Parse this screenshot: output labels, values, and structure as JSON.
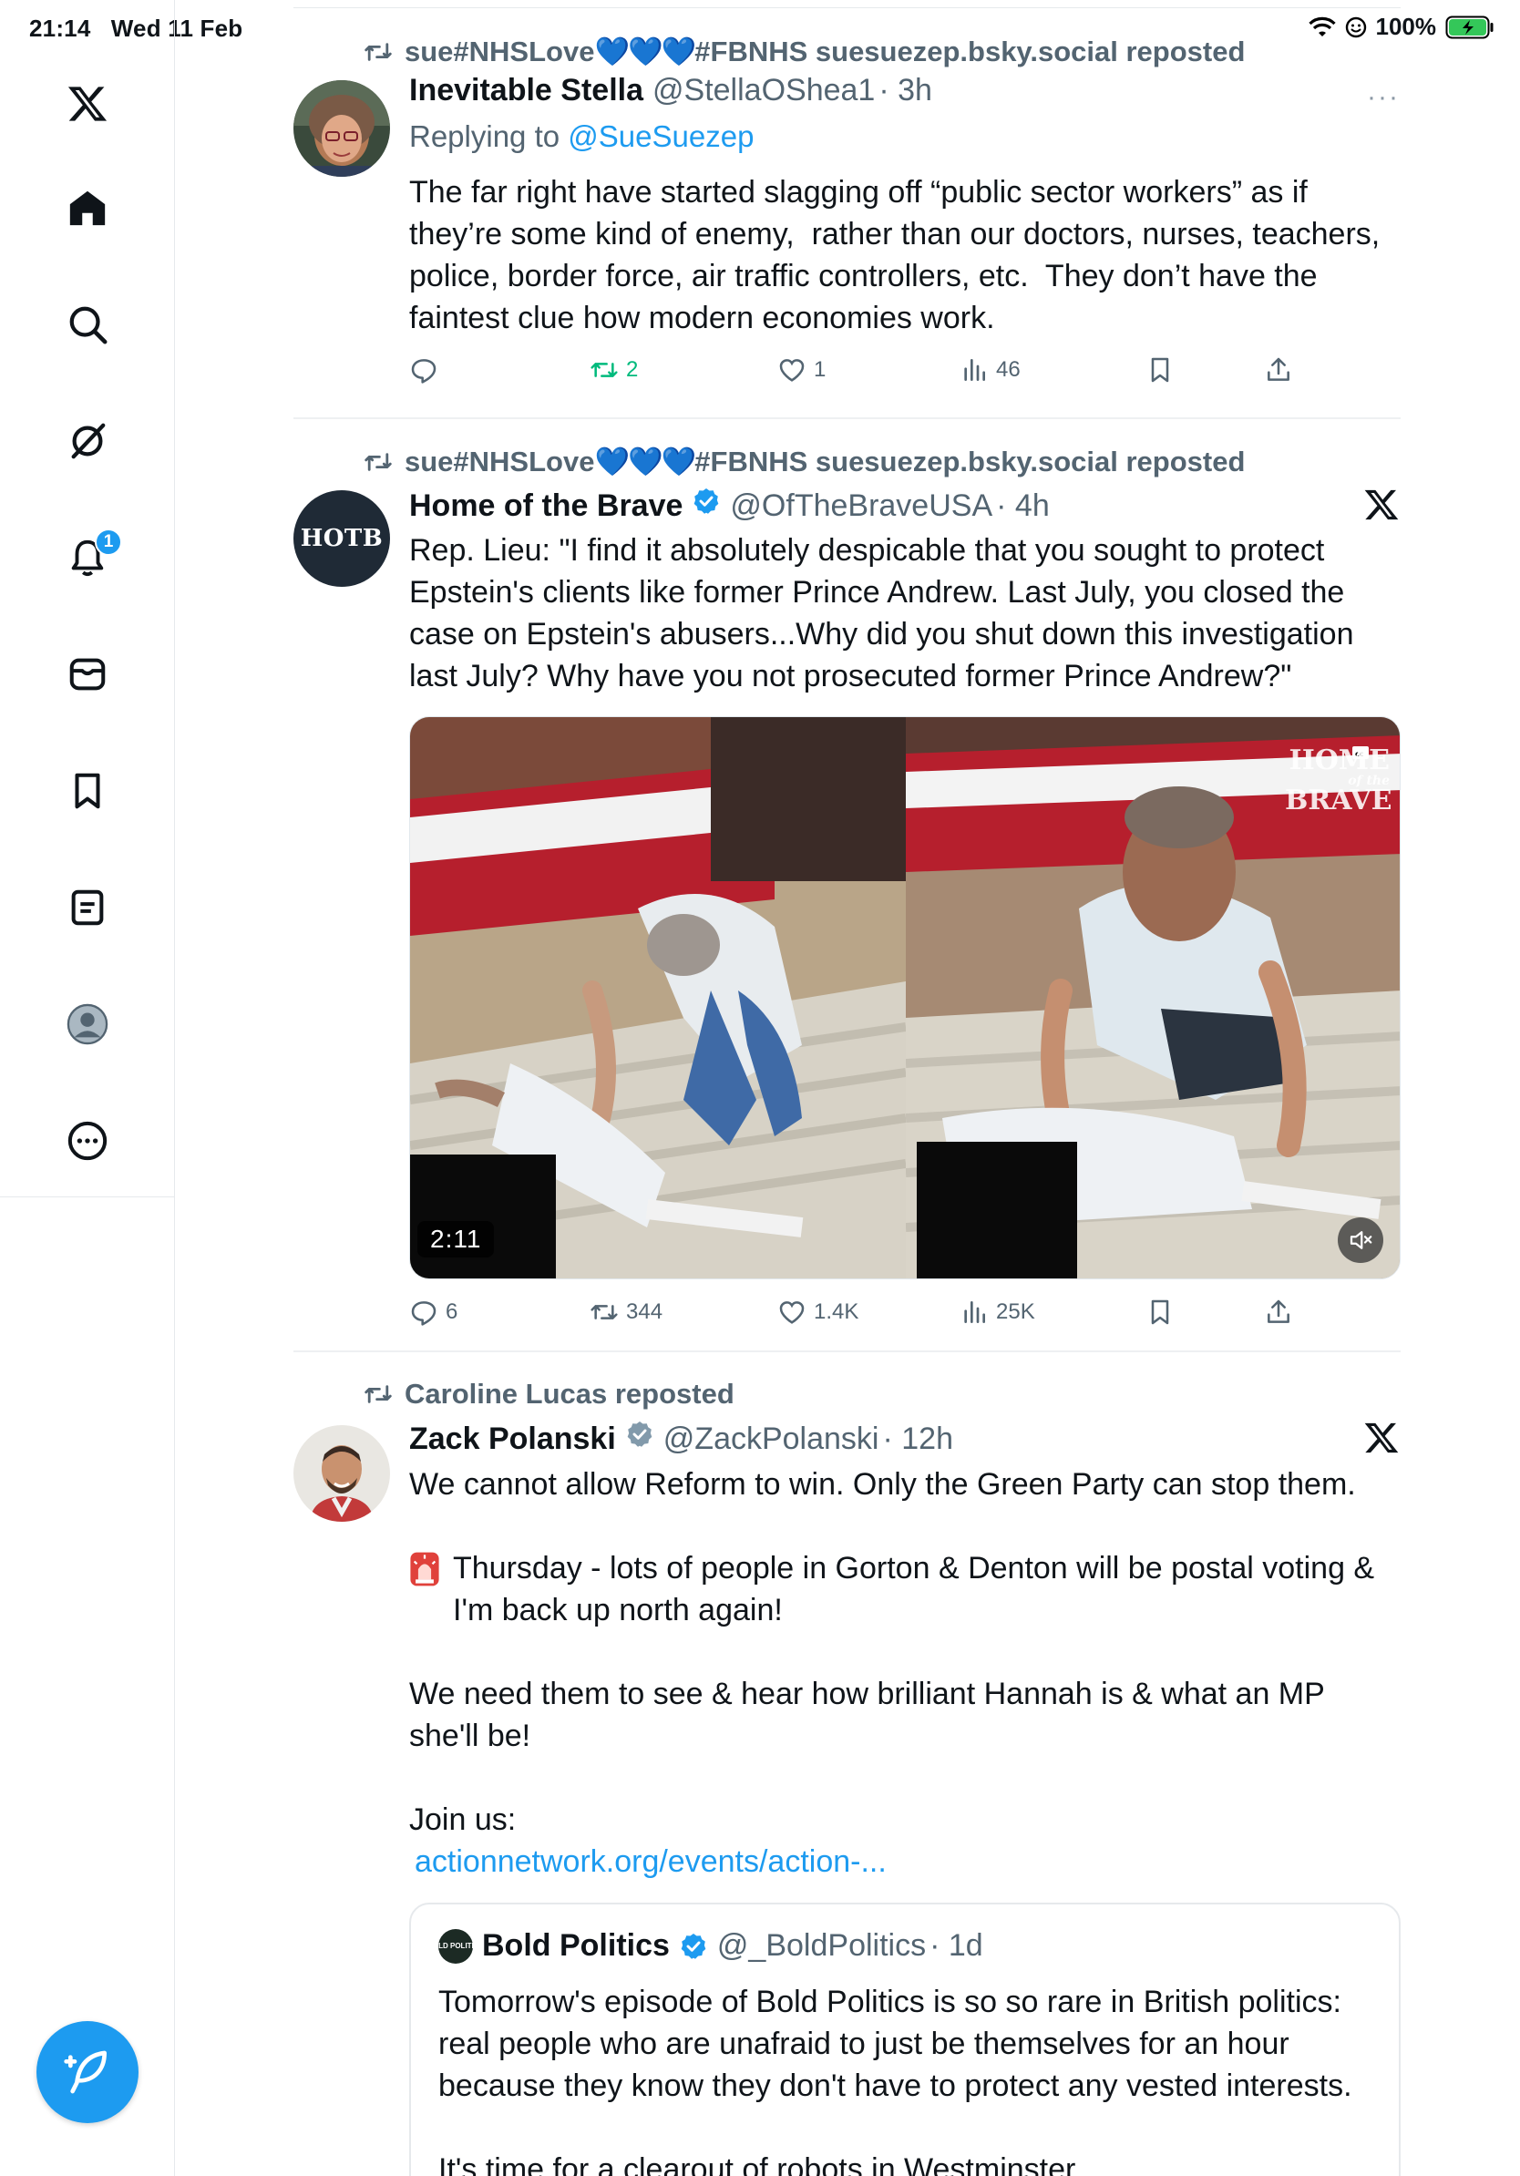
{
  "status_bar": {
    "time": "21:14",
    "date": "Wed 11 Feb",
    "battery": "100%"
  },
  "sidebar": {
    "items": [
      {
        "name": "x-logo"
      },
      {
        "name": "home"
      },
      {
        "name": "search"
      },
      {
        "name": "grok"
      },
      {
        "name": "notifications",
        "badge": "1"
      },
      {
        "name": "messages"
      },
      {
        "name": "bookmarks"
      },
      {
        "name": "lists"
      },
      {
        "name": "profile"
      },
      {
        "name": "more"
      }
    ]
  },
  "posts": [
    {
      "repost_by": "sue#NHSLove",
      "repost_hearts": "💙💙💙",
      "repost_suffix": "#FBNHS suesuezep.bsky.social reposted",
      "name": "Inevitable Stella",
      "handle": "@StellaOShea1",
      "time": "· 3h",
      "replying_label": "Replying to",
      "replying_to": "@SueSuezep",
      "text": "The far right have started slagging off “public sector workers” as if they’re some kind of enemy,  rather than our doctors, nurses, teachers, police, border force, air traffic controllers, etc.  They don’t have the faintest clue how modern economies work.",
      "more": "···",
      "replies": "",
      "reposts": "2",
      "likes": "1",
      "views": "46"
    },
    {
      "repost_by": "sue#NHSLove",
      "repost_hearts": "💙💙💙",
      "repost_suffix": "#FBNHS suesuezep.bsky.social reposted",
      "avatar_text": "HOTB",
      "name": "Home of the Brave",
      "handle": "@OfTheBraveUSA",
      "time": "· 4h",
      "text": "Rep. Lieu: \"I find it absolutely despicable that you sought to protect Epstein's clients like former Prince Andrew. Last July, you closed the case on Epstein's abusers...Why did you shut down this investigation last July? Why have you not prosecuted former Prince Andrew?\"",
      "video_duration": "2:11",
      "watermark": {
        "top": "HOME",
        "mid": "of the",
        "bottom": "BRAVE"
      },
      "replies": "6",
      "reposts": "344",
      "likes": "1.4K",
      "views": "25K"
    },
    {
      "repost_by": "Caroline Lucas reposted",
      "name": "Zack Polanski",
      "handle": "@ZackPolanski",
      "time": "· 12h",
      "text_1": "We cannot allow Reform to win. Only the Green Party can stop them.",
      "text_2": "Thursday - lots of people in Gorton & Denton will be postal voting & I'm back up north again!",
      "text_3": "We need them to see & hear how brilliant Hannah is & what an MP she'll be!",
      "text_4": "Join us:",
      "link": "actionnetwork.org/events/action-...",
      "quote": {
        "avatar_text": "BOLD POLITICS",
        "name": "Bold Politics",
        "handle": "@_BoldPolitics",
        "time": "· 1d",
        "text": "Tomorrow's episode of Bold Politics is so so rare in British politics: real people who are unafraid to just be themselves for an hour because they know they don't have to protect any vested interests.\n\nIt's time for a clearout of robots in Westminster."
      }
    }
  ],
  "colors": {
    "accent": "#1d9bf0",
    "repost_green": "#00ba7c",
    "muted": "#536471"
  }
}
